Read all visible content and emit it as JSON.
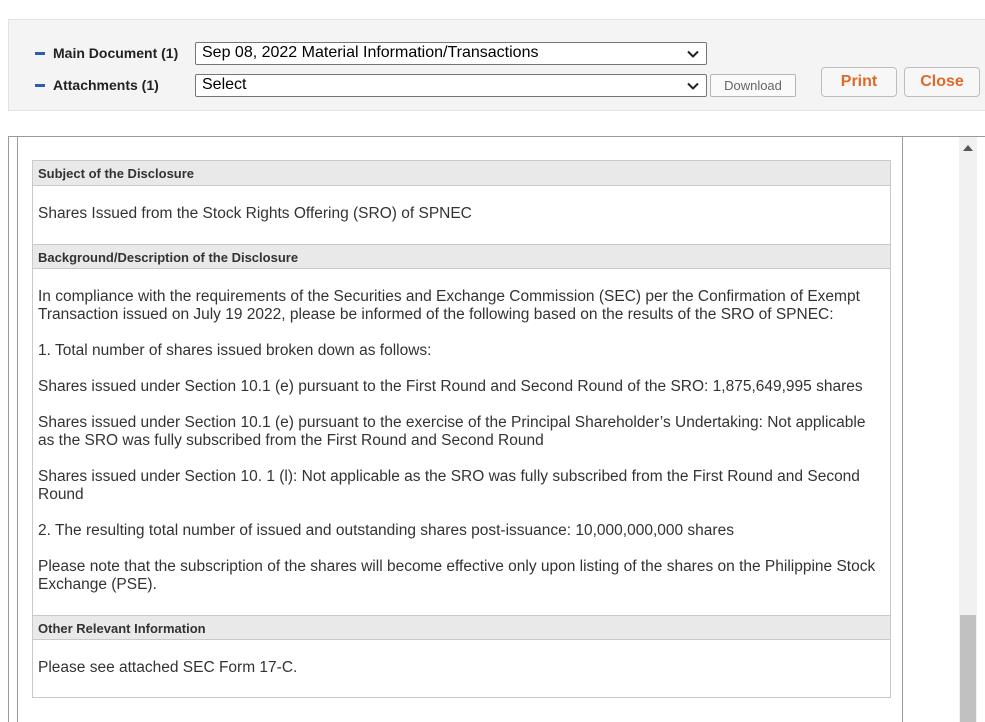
{
  "toolbar": {
    "main_document_label": "Main Document (1)",
    "main_document_value": "Sep 08, 2022  Material Information/Transactions",
    "attachments_label": "Attachments (1)",
    "attachments_value": "Select",
    "download_label": "Download",
    "print_label": "Print",
    "close_label": "Close"
  },
  "disclosure": {
    "sections": [
      {
        "heading": "Subject of the Disclosure",
        "paragraphs": [
          "Shares Issued from the Stock Rights Offering (SRO) of SPNEC"
        ]
      },
      {
        "heading": "Background/Description of the Disclosure",
        "paragraphs": [
          "In compliance with the requirements of the Securities and Exchange Commission (SEC) per the Confirmation of Exempt Transaction issued on July 19 2022, please be informed of the following based on the results of the SRO of SPNEC:",
          "1. Total number of shares issued broken down as follows:",
          "Shares issued under Section 10.1 (e) pursuant to the First Round and Second Round of the SRO: 1,875,649,995 shares",
          "Shares issued under Section 10.1 (e) pursuant to the exercise of the Principal Shareholder’s Undertaking: Not applicable as the SRO was fully subscribed from the First Round and Second Round",
          "Shares issued under Section 10. 1 (l): Not applicable as the SRO was fully subscribed from the First Round and Second Round",
          "2. The resulting total number of issued and outstanding shares post-issuance: 10,000,000,000 shares",
          "Please note that the subscription of the shares will become effective only upon listing of the shares on the Philippine Stock Exchange (PSE)."
        ]
      },
      {
        "heading": "Other Relevant Information",
        "paragraphs": [
          "Please see attached SEC Form 17-C."
        ]
      }
    ]
  },
  "icons": {
    "collapse": "minus-icon",
    "dropdown": "chevron-down-icon",
    "scroll_up": "triangle-up-icon"
  },
  "colors": {
    "accent_button_text": "#e0692a",
    "collapse_icon": "#2d5fa8"
  }
}
